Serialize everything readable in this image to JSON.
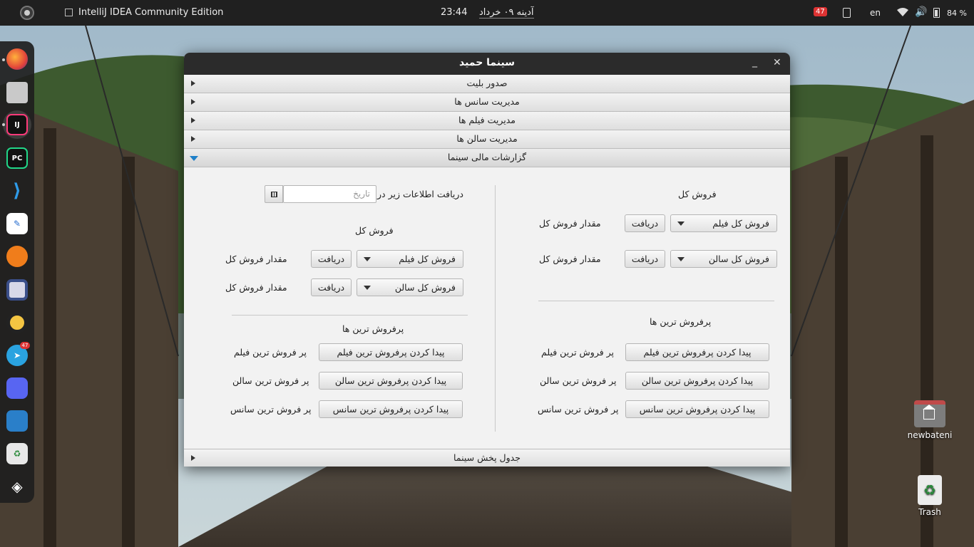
{
  "topbar": {
    "app_title": "IntelliJ IDEA Community Edition",
    "time": "23:44",
    "date": "آدینه ۰۹ خرداد",
    "notif_count": "47",
    "lang": "en",
    "battery": "84 %"
  },
  "dock": {
    "items": [
      "firefox",
      "files",
      "intellij",
      "pycharm",
      "vscode",
      "text-editor",
      "app-6",
      "screenshot",
      "rhythmbox",
      "telegram",
      "discord",
      "system-monitor",
      "trash-app",
      "anydesk"
    ],
    "intellij_label": "IJ",
    "pycharm_label": "PC",
    "telegram_badge": "47"
  },
  "desktop": {
    "folder_label": "newbateni",
    "trash_label": "Trash"
  },
  "window": {
    "title": "سینما حمید",
    "sections": [
      "صدور بلیت",
      "مدیریت سانس ها",
      "مدیریت فیلم ها",
      "مدیریت سالن ها",
      "گزارشات مالی سینما"
    ],
    "bottom_section": "جدول پخش سینما",
    "right_panel": {
      "total_heading": "فروش کل",
      "rows": [
        {
          "combo": "فروش کل فیلم",
          "button": "دریافت",
          "label": "مقدار فروش کل"
        },
        {
          "combo": "فروش کل سالن",
          "button": "دریافت",
          "label": "مقدار فروش کل"
        }
      ],
      "best_heading": "پرفروش ترین ها",
      "best_rows": [
        {
          "button": "پیدا کردن پرفروش ترین فیلم",
          "label": "پر فروش ترین فیلم"
        },
        {
          "button": "پیدا کردن پرفروش ترین سالن",
          "label": "پر فروش ترین سالن"
        },
        {
          "button": "پیدا کردن پرفروش ترین سانس",
          "label": "پر فروش ترین سانس"
        }
      ]
    },
    "left_panel": {
      "date_label": "دریافت اطلاعات زیر در",
      "date_placeholder": "تاریخ",
      "total_heading": "فروش کل",
      "rows": [
        {
          "combo": "فروش کل فیلم",
          "button": "دریافت",
          "label": "مقدار فروش کل"
        },
        {
          "combo": "فروش کل سالن",
          "button": "دریافت",
          "label": "مقدار فروش کل"
        }
      ],
      "best_heading": "پرفروش ترین ها",
      "best_rows": [
        {
          "button": "پیدا کردن پرفروش ترین فیلم",
          "label": "پر فروش ترین فیلم"
        },
        {
          "button": "پیدا کردن پرفروش ترین سالن",
          "label": "پر فروش ترین سالن"
        },
        {
          "button": "پیدا کردن پرفروش ترین سانس",
          "label": "پر فروش ترین سانس"
        }
      ]
    }
  }
}
